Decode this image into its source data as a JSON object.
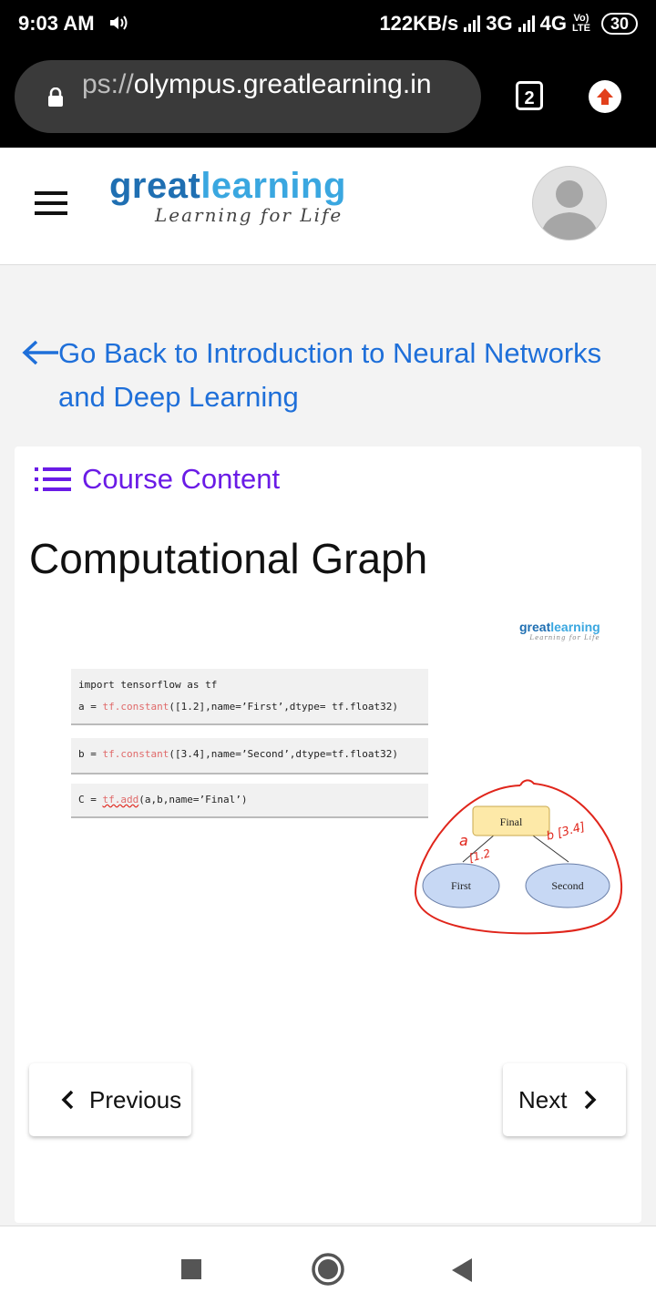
{
  "status_bar": {
    "time": "9:03 AM",
    "speed": "122KB/s",
    "net1": "3G",
    "net2": "4G",
    "volte_top": "Vo)",
    "volte_bottom": "LTE",
    "battery": "30"
  },
  "browser": {
    "url_prefix": "ps://",
    "url_host": "olympus.greatlearning.in",
    "tab_count": "2"
  },
  "header": {
    "logo_part1": "great",
    "logo_part2": "learning",
    "tagline": "Learning for Life"
  },
  "back_link": {
    "text": "Go Back to Introduction to Neural Networks and Deep Learning"
  },
  "card": {
    "course_content": "Course Content",
    "title": "Computational Graph"
  },
  "slide": {
    "logo_part1": "great",
    "logo_part2": "learning",
    "tagline": "Learning for Life",
    "code1_line1": "import tensorflow as tf",
    "code1_line2_pre": "a = ",
    "code1_line2_fn": "tf.constant",
    "code1_line2_post": "([1.2],name=’First’,dtype= tf.float32)",
    "code2_pre": "b = ",
    "code2_fn": "tf.constant",
    "code2_post": "([3.4],name=’Second’,dtype=tf.float32)",
    "code3_pre": "C = ",
    "code3_fn": "tf.add",
    "code3_post": "(a,b,name=’Final’)",
    "node_final": "Final",
    "node_first": "First",
    "node_second": "Second",
    "annot_a": "a",
    "annot_a_val": "[1.2",
    "annot_b": "b [3.4]"
  },
  "pager": {
    "previous": "Previous",
    "next": "Next"
  },
  "colors": {
    "link": "#1e6fd9",
    "course_content": "#6a1be6",
    "brand_dark": "#1f6fb2",
    "brand_light": "#3aa7e0",
    "annotation_red": "#e0251b"
  }
}
